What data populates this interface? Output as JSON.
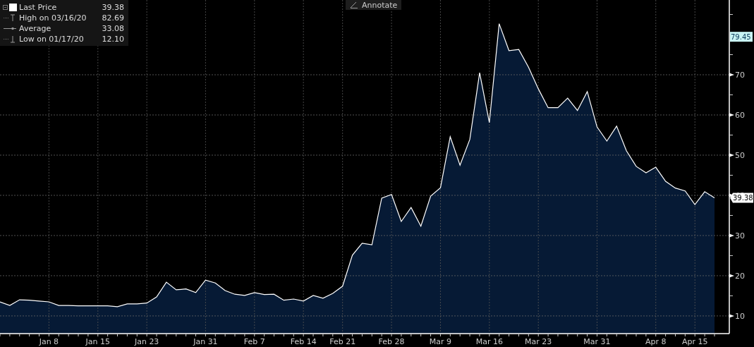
{
  "legend": [
    {
      "kind": "last",
      "value": "39.38"
    },
    {
      "kind": "high",
      "label": "High on 03/16/20",
      "value": "82.69"
    },
    {
      "kind": "average",
      "label": "Average",
      "value": "33.08"
    },
    {
      "kind": "low",
      "label": "Low on 01/17/20",
      "value": "12.10"
    }
  ],
  "toolbar": {
    "annotate": "Annotate"
  },
  "chart": {
    "chart_data": {
      "type": "area",
      "categories": [
        null,
        null,
        null,
        null,
        null,
        "Jan 8",
        null,
        null,
        null,
        null,
        "Jan 15",
        null,
        null,
        null,
        null,
        "Jan 23",
        null,
        null,
        null,
        null,
        null,
        "Jan 31",
        null,
        null,
        null,
        null,
        "Feb 7",
        null,
        null,
        null,
        null,
        "Feb 14",
        null,
        null,
        null,
        "Feb 21",
        null,
        null,
        null,
        null,
        "Feb 28",
        null,
        null,
        null,
        null,
        "Mar 9",
        null,
        null,
        null,
        null,
        "Mar 16",
        null,
        null,
        null,
        null,
        "Mar 23",
        null,
        null,
        null,
        null,
        null,
        "Mar 31",
        null,
        null,
        null,
        null,
        null,
        "Apr 8",
        null,
        null,
        null,
        "Apr 15",
        null,
        null
      ],
      "series": [
        {
          "name": "Last Price",
          "color": "#ffffff",
          "values": [
            13.5,
            12.6,
            14.0,
            13.9,
            13.7,
            13.5,
            12.6,
            12.6,
            12.5,
            12.5,
            12.5,
            12.5,
            12.3,
            13.0,
            13.0,
            13.2,
            14.7,
            18.4,
            16.5,
            16.7,
            15.8,
            18.9,
            18.2,
            16.3,
            15.4,
            15.1,
            15.8,
            15.3,
            15.4,
            13.9,
            14.2,
            13.7,
            15.1,
            14.4,
            15.6,
            17.4,
            25.1,
            28.1,
            27.7,
            39.3,
            40.2,
            33.5,
            37.0,
            32.3,
            39.8,
            41.9,
            54.6,
            47.5,
            53.9,
            70.5,
            58.1,
            82.7,
            76.0,
            76.3,
            71.9,
            66.5,
            61.8,
            61.8,
            64.2,
            61.1,
            65.8,
            57.0,
            53.5,
            57.2,
            51.1,
            47.2,
            45.6,
            47.0,
            43.5,
            41.8,
            41.1,
            37.7,
            40.9,
            39.4
          ]
        }
      ],
      "ylim": [
        5.6,
        88.6
      ],
      "grid": true,
      "yticks": [
        10,
        20,
        30,
        40,
        50,
        60,
        70
      ],
      "annotations": [
        {
          "y": 79.45,
          "text": "79.45"
        },
        {
          "y": 39.38,
          "text": "39.38"
        }
      ]
    }
  }
}
